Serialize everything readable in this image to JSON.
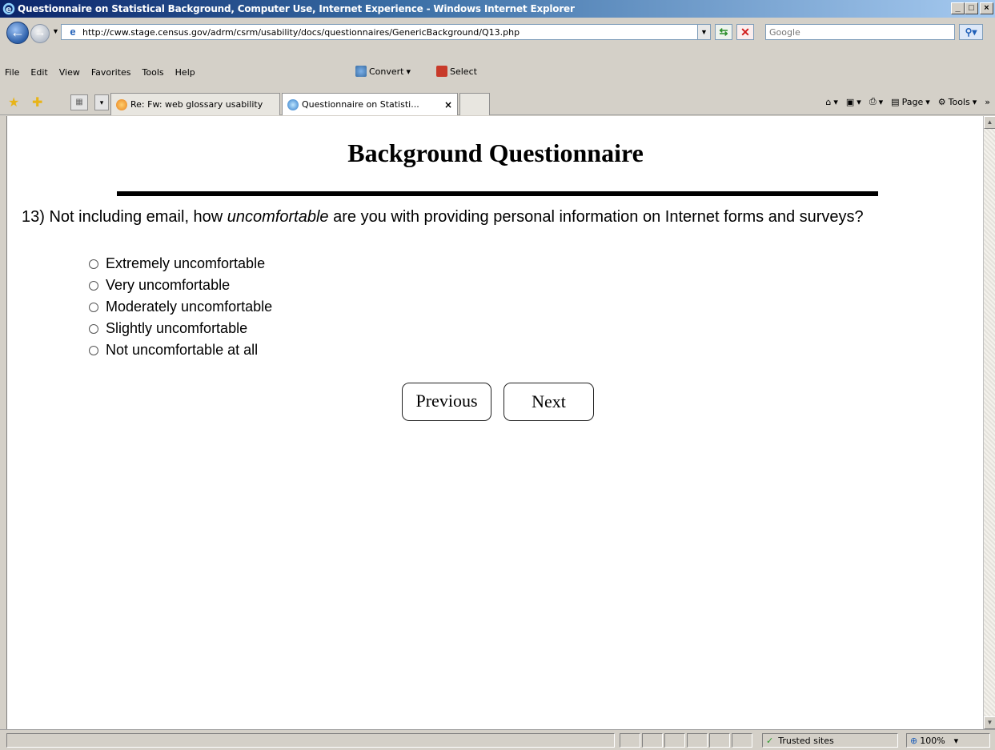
{
  "window": {
    "title": "Questionnaire on Statistical Background, Computer Use, Internet Experience - Windows Internet Explorer",
    "minimize_glyph": "_",
    "maximize_glyph": "□",
    "close_glyph": "×"
  },
  "address": {
    "url": "http://cww.stage.census.gov/adrm/csrm/usability/docs/questionnaires/GenericBackground/Q13.php",
    "search_placeholder": "Google"
  },
  "menu": {
    "items": [
      "File",
      "Edit",
      "View",
      "Favorites",
      "Tools",
      "Help"
    ],
    "convert_label": "Convert",
    "select_label": "Select"
  },
  "tabs": {
    "items": [
      {
        "label": "Re: Fw: web glossary usability",
        "icon": "outlook-icon"
      },
      {
        "label": "Questionnaire on Statisti...",
        "icon": "ie-icon",
        "close": "×"
      }
    ]
  },
  "command_bar": {
    "page_label": "Page",
    "tools_label": "Tools",
    "overflow": "»"
  },
  "page": {
    "heading": "Background Questionnaire",
    "question_prefix": "13) Not including email, how ",
    "question_emphasis": "uncomfortable",
    "question_suffix": " are you with providing personal information on Internet forms and surveys?",
    "options": [
      "Extremely uncomfortable",
      "Very uncomfortable",
      "Moderately uncomfortable",
      "Slightly uncomfortable",
      "Not uncomfortable at all"
    ],
    "previous_label": "Previous",
    "next_label": "Next"
  },
  "status": {
    "zone": "Trusted sites",
    "zoom": "100%"
  },
  "colors": {
    "title_bar": "#0a246a",
    "chrome": "#d4d0c8",
    "rule": "#000000"
  }
}
